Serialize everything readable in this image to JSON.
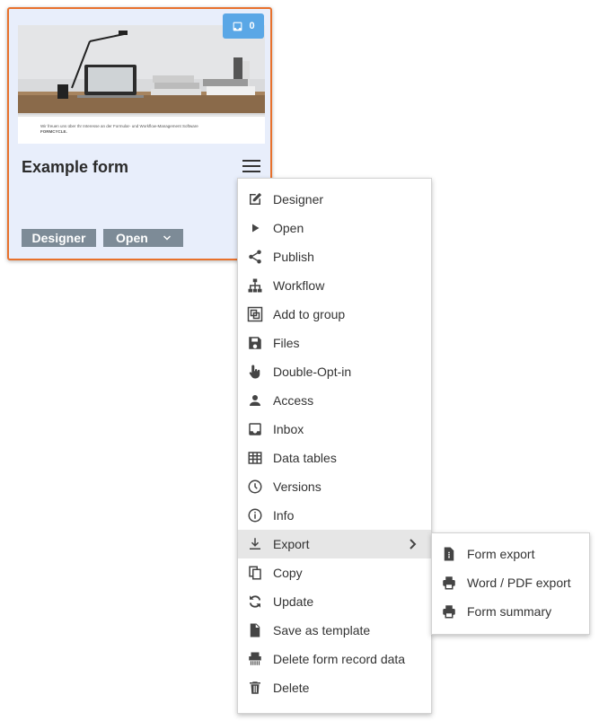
{
  "card": {
    "title": "Example form",
    "badge_count": "0",
    "thumbnail_text_line1": "Wir freuen uns über Ihr Interesse an der Formular- und Workflow-Management Software",
    "thumbnail_text_line2": "FORMCYCLE.",
    "designer_label": "Designer",
    "open_label": "Open"
  },
  "menu": {
    "items": [
      {
        "label": "Designer",
        "icon": "edit-icon"
      },
      {
        "label": "Open",
        "icon": "play-icon"
      },
      {
        "label": "Publish",
        "icon": "share-icon"
      },
      {
        "label": "Workflow",
        "icon": "sitemap-icon"
      },
      {
        "label": "Add to group",
        "icon": "group-icon"
      },
      {
        "label": "Files",
        "icon": "save-icon"
      },
      {
        "label": "Double-Opt-in",
        "icon": "hand-pointer-icon"
      },
      {
        "label": "Access",
        "icon": "user-icon"
      },
      {
        "label": "Inbox",
        "icon": "inbox-icon"
      },
      {
        "label": "Data tables",
        "icon": "table-icon"
      },
      {
        "label": "Versions",
        "icon": "clock-icon"
      },
      {
        "label": "Info",
        "icon": "info-icon"
      },
      {
        "label": "Export",
        "icon": "download-icon"
      },
      {
        "label": "Copy",
        "icon": "copy-icon"
      },
      {
        "label": "Update",
        "icon": "refresh-icon"
      },
      {
        "label": "Save as template",
        "icon": "file-icon"
      },
      {
        "label": "Delete form record data",
        "icon": "shredder-icon"
      },
      {
        "label": "Delete",
        "icon": "trash-icon"
      }
    ]
  },
  "submenu": {
    "items": [
      {
        "label": "Form export",
        "icon": "file-zip-icon"
      },
      {
        "label": "Word / PDF export",
        "icon": "print-icon"
      },
      {
        "label": "Form summary",
        "icon": "print-icon"
      }
    ]
  },
  "colors": {
    "card_bg": "#e8eefb",
    "card_border": "#e8712c",
    "badge_bg": "#5aa7e6",
    "button_bg": "#7d8b97",
    "active_item_bg": "#e6e6e6"
  }
}
